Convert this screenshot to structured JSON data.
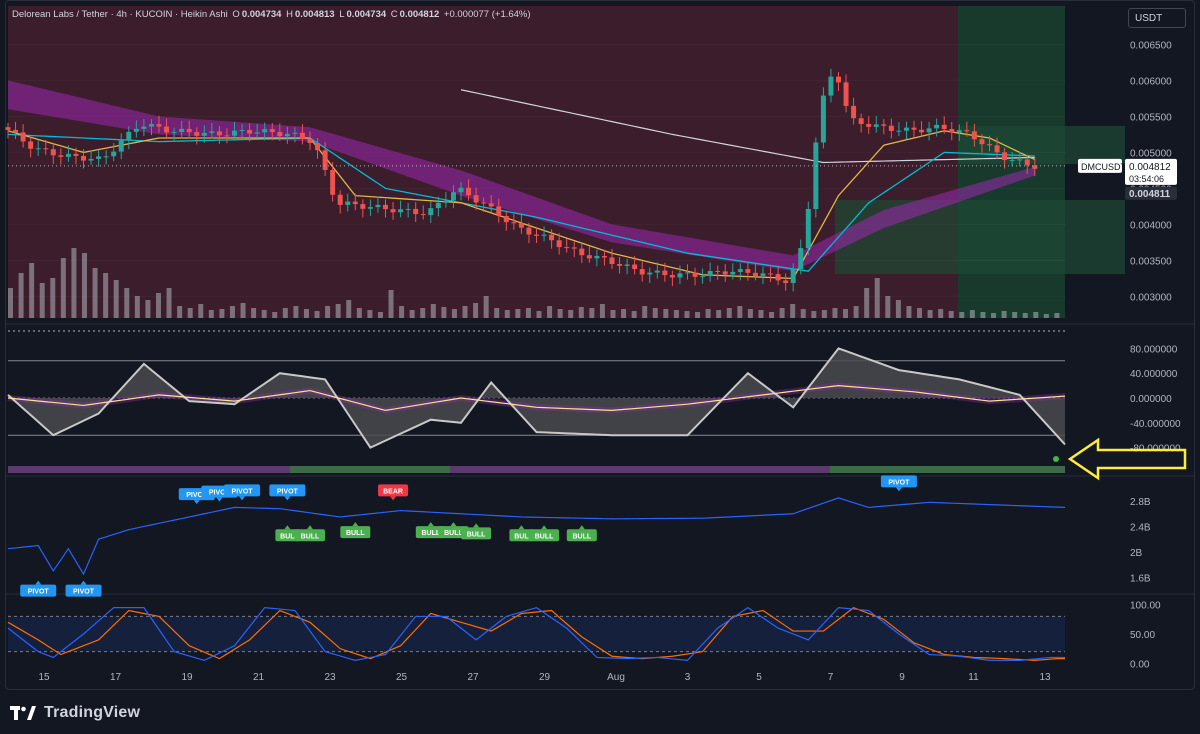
{
  "legend": {
    "title": "Delorean Labs / Tether · 4h · KUCOIN · Heikin Ashi",
    "open_label": "O",
    "open": "0.004734",
    "high_label": "H",
    "high": "0.004813",
    "low_label": "L",
    "low": "0.004734",
    "close_label": "C",
    "close": "0.004812",
    "change": "+0.000077 (+1.64%)"
  },
  "quote_currency": "USDT",
  "price_tags": {
    "symbol": "DMCUSDT",
    "last": "0.004812",
    "countdown": "03:54:06",
    "secondary": "0.004811"
  },
  "footer": {
    "brand": "TradingView"
  },
  "colors": {
    "background": "#131722",
    "bull": "#26a69a",
    "bear": "#ef5350",
    "ribbon": "#9c27b0",
    "pivot": "#2196f3",
    "bear_label": "#f23645",
    "bull_label": "#4caf50",
    "arrow": "#ffeb3b"
  },
  "chart_data": [
    {
      "type": "candlestick",
      "name": "main",
      "ylim": [
        0.0027,
        0.0067
      ],
      "y_ticks": [
        "0.006500",
        "0.006000",
        "0.005500",
        "0.005000",
        "0.004500",
        "0.004000",
        "0.003500",
        "0.003000"
      ],
      "x_ticks": [
        "15",
        "17",
        "19",
        "21",
        "23",
        "25",
        "27",
        "29",
        "Aug",
        "3",
        "5",
        "7",
        "9",
        "11",
        "13"
      ],
      "close_path": [
        [
          0,
          0.00535
        ],
        [
          4,
          0.00505
        ],
        [
          8,
          0.00495
        ],
        [
          13,
          0.0049
        ],
        [
          18,
          0.0054
        ],
        [
          22,
          0.0053
        ],
        [
          28,
          0.00525
        ],
        [
          33,
          0.0053
        ],
        [
          38,
          0.00525
        ],
        [
          41,
          0.00515
        ],
        [
          44,
          0.0043
        ],
        [
          48,
          0.00425
        ],
        [
          52,
          0.0042
        ],
        [
          56,
          0.00415
        ],
        [
          60,
          0.0045
        ],
        [
          64,
          0.00425
        ],
        [
          68,
          0.00395
        ],
        [
          72,
          0.0038
        ],
        [
          76,
          0.0036
        ],
        [
          80,
          0.0035
        ],
        [
          84,
          0.00335
        ],
        [
          88,
          0.0033
        ],
        [
          92,
          0.0033
        ],
        [
          96,
          0.00335
        ],
        [
          100,
          0.00332
        ],
        [
          104,
          0.0032
        ],
        [
          106,
          0.0038
        ],
        [
          108,
          0.0056
        ],
        [
          110,
          0.0062
        ],
        [
          112,
          0.00545
        ],
        [
          116,
          0.00535
        ],
        [
          120,
          0.0053
        ],
        [
          124,
          0.00535
        ],
        [
          128,
          0.00525
        ],
        [
          132,
          0.00495
        ],
        [
          136,
          0.00481
        ]
      ],
      "ma_long": [
        [
          60,
          0.00587
        ],
        [
          88,
          0.00525
        ],
        [
          108,
          0.00486
        ],
        [
          136,
          0.00493
        ]
      ],
      "ema_fast": [
        [
          0,
          0.0053
        ],
        [
          10,
          0.005
        ],
        [
          20,
          0.0052
        ],
        [
          40,
          0.0052
        ],
        [
          46,
          0.0044
        ],
        [
          60,
          0.0043
        ],
        [
          70,
          0.00395
        ],
        [
          80,
          0.0036
        ],
        [
          92,
          0.0033
        ],
        [
          104,
          0.00325
        ],
        [
          110,
          0.0044
        ],
        [
          116,
          0.0051
        ],
        [
          124,
          0.0053
        ],
        [
          130,
          0.0052
        ],
        [
          136,
          0.0049
        ]
      ],
      "ema_slow": [
        [
          0,
          0.00525
        ],
        [
          20,
          0.00515
        ],
        [
          40,
          0.0052
        ],
        [
          50,
          0.0045
        ],
        [
          70,
          0.0041
        ],
        [
          90,
          0.0036
        ],
        [
          106,
          0.00335
        ],
        [
          114,
          0.0043
        ],
        [
          124,
          0.005
        ],
        [
          136,
          0.00495
        ]
      ],
      "ribbon_top": [
        [
          0,
          0.006
        ],
        [
          20,
          0.0055
        ],
        [
          40,
          0.00535
        ],
        [
          60,
          0.00475
        ],
        [
          80,
          0.004
        ],
        [
          104,
          0.00357
        ],
        [
          116,
          0.0042
        ],
        [
          136,
          0.0048
        ]
      ],
      "ribbon_bottom": [
        [
          0,
          0.0056
        ],
        [
          20,
          0.00525
        ],
        [
          40,
          0.00515
        ],
        [
          60,
          0.0044
        ],
        [
          80,
          0.00375
        ],
        [
          104,
          0.00335
        ],
        [
          116,
          0.00395
        ],
        [
          136,
          0.00468
        ]
      ],
      "volume": [
        30,
        45,
        55,
        35,
        40,
        60,
        70,
        65,
        50,
        45,
        38,
        30,
        22,
        18,
        25,
        30,
        12,
        10,
        14,
        8,
        9,
        12,
        15,
        10,
        8,
        6,
        10,
        12,
        9,
        7,
        12,
        14,
        18,
        10,
        8,
        6,
        28,
        12,
        8,
        10,
        14,
        11,
        9,
        12,
        15,
        22,
        10,
        8,
        9,
        10,
        7,
        12,
        9,
        8,
        11,
        10,
        14,
        8,
        9,
        7,
        12,
        10,
        9,
        8,
        7,
        6,
        9,
        8,
        10,
        12,
        9,
        8,
        6,
        10,
        14,
        9,
        7,
        8,
        10,
        9,
        12,
        30,
        40,
        22,
        18,
        12,
        10,
        8,
        9,
        7,
        6,
        8,
        6,
        5,
        7,
        6,
        5,
        6,
        4,
        5
      ]
    },
    {
      "type": "line",
      "name": "oscillator",
      "ylim": [
        -100,
        100
      ],
      "y_ticks": [
        "80.000000",
        "40.000000",
        "0.000000",
        "-40.000000",
        "-80.000000"
      ],
      "levels": [
        60,
        -60
      ],
      "wave": [
        [
          0,
          5
        ],
        [
          6,
          -60
        ],
        [
          12,
          -25
        ],
        [
          18,
          55
        ],
        [
          24,
          -5
        ],
        [
          30,
          -10
        ],
        [
          36,
          40
        ],
        [
          42,
          30
        ],
        [
          48,
          -80
        ],
        [
          56,
          -35
        ],
        [
          60,
          -40
        ],
        [
          64,
          25
        ],
        [
          70,
          -55
        ],
        [
          80,
          -60
        ],
        [
          90,
          -60
        ],
        [
          98,
          40
        ],
        [
          104,
          -15
        ],
        [
          110,
          80
        ],
        [
          118,
          45
        ],
        [
          126,
          30
        ],
        [
          134,
          5
        ],
        [
          140,
          -75
        ]
      ],
      "signal": [
        [
          0,
          0
        ],
        [
          10,
          -12
        ],
        [
          20,
          5
        ],
        [
          30,
          -5
        ],
        [
          40,
          12
        ],
        [
          50,
          -20
        ],
        [
          60,
          0
        ],
        [
          70,
          -15
        ],
        [
          80,
          -20
        ],
        [
          90,
          -10
        ],
        [
          100,
          5
        ],
        [
          110,
          20
        ],
        [
          120,
          10
        ],
        [
          130,
          -5
        ],
        [
          140,
          3
        ]
      ]
    },
    {
      "type": "line",
      "name": "volume-trend",
      "ylim": [
        1.4,
        3.1
      ],
      "y_ticks": [
        "2.8B",
        "2.4B",
        "2B",
        "1.6B"
      ],
      "series": [
        [
          0,
          2.05
        ],
        [
          4,
          2.1
        ],
        [
          6,
          1.7
        ],
        [
          8,
          2.05
        ],
        [
          10,
          1.65
        ],
        [
          12,
          2.2
        ],
        [
          16,
          2.35
        ],
        [
          22,
          2.5
        ],
        [
          30,
          2.7
        ],
        [
          36,
          2.68
        ],
        [
          44,
          2.55
        ],
        [
          52,
          2.65
        ],
        [
          60,
          2.6
        ],
        [
          68,
          2.55
        ],
        [
          80,
          2.52
        ],
        [
          92,
          2.53
        ],
        [
          104,
          2.6
        ],
        [
          110,
          2.85
        ],
        [
          114,
          2.7
        ],
        [
          122,
          2.78
        ],
        [
          140,
          2.7
        ]
      ],
      "labels": [
        {
          "text": "PIVOT",
          "kind": "pivot-up",
          "x": 25,
          "y": 2.72
        },
        {
          "text": "PIVOT",
          "kind": "pivot-up",
          "x": 28,
          "y": 2.76
        },
        {
          "text": "PIVOT",
          "kind": "pivot-up",
          "x": 31,
          "y": 2.78
        },
        {
          "text": "PIVOT",
          "kind": "pivot-up",
          "x": 37,
          "y": 2.78
        },
        {
          "text": "BEAR",
          "kind": "bear",
          "x": 51,
          "y": 2.78
        },
        {
          "text": "PIVOT",
          "kind": "pivot-up",
          "x": 118,
          "y": 2.92
        },
        {
          "text": "PIVOT",
          "kind": "pivot-down",
          "x": 4,
          "y": 1.58
        },
        {
          "text": "PIVOT",
          "kind": "pivot-down",
          "x": 10,
          "y": 1.58
        },
        {
          "text": "BUL",
          "kind": "bull",
          "x": 37,
          "y": 2.45
        },
        {
          "text": "BULL",
          "kind": "bull",
          "x": 40,
          "y": 2.45
        },
        {
          "text": "BULL",
          "kind": "bull",
          "x": 46,
          "y": 2.5
        },
        {
          "text": "BULL",
          "kind": "bull",
          "x": 56,
          "y": 2.5
        },
        {
          "text": "BULL",
          "kind": "bull",
          "x": 59,
          "y": 2.5
        },
        {
          "text": "BULL",
          "kind": "bull",
          "x": 62,
          "y": 2.48
        },
        {
          "text": "BUL",
          "kind": "bull",
          "x": 68,
          "y": 2.45
        },
        {
          "text": "BULL",
          "kind": "bull",
          "x": 71,
          "y": 2.45
        },
        {
          "text": "BULL",
          "kind": "bull",
          "x": 76,
          "y": 2.45
        }
      ]
    },
    {
      "type": "line",
      "name": "stochastic",
      "ylim": [
        -8,
        108
      ],
      "y_ticks": [
        "100.00",
        "50.00",
        "0.00"
      ],
      "levels": [
        80,
        20
      ],
      "k": [
        [
          0,
          60
        ],
        [
          4,
          20
        ],
        [
          6,
          10
        ],
        [
          10,
          50
        ],
        [
          14,
          95
        ],
        [
          18,
          95
        ],
        [
          22,
          20
        ],
        [
          26,
          5
        ],
        [
          30,
          30
        ],
        [
          34,
          95
        ],
        [
          38,
          90
        ],
        [
          42,
          20
        ],
        [
          46,
          5
        ],
        [
          50,
          15
        ],
        [
          54,
          80
        ],
        [
          58,
          80
        ],
        [
          62,
          40
        ],
        [
          66,
          80
        ],
        [
          70,
          95
        ],
        [
          74,
          60
        ],
        [
          78,
          10
        ],
        [
          82,
          8
        ],
        [
          86,
          10
        ],
        [
          90,
          5
        ],
        [
          94,
          60
        ],
        [
          98,
          95
        ],
        [
          102,
          60
        ],
        [
          106,
          40
        ],
        [
          110,
          95
        ],
        [
          114,
          90
        ],
        [
          118,
          50
        ],
        [
          122,
          15
        ],
        [
          126,
          12
        ],
        [
          130,
          5
        ],
        [
          134,
          5
        ],
        [
          138,
          10
        ]
      ],
      "d": [
        [
          0,
          70
        ],
        [
          4,
          40
        ],
        [
          7,
          15
        ],
        [
          12,
          40
        ],
        [
          16,
          90
        ],
        [
          20,
          80
        ],
        [
          24,
          30
        ],
        [
          28,
          8
        ],
        [
          32,
          40
        ],
        [
          36,
          90
        ],
        [
          40,
          70
        ],
        [
          44,
          25
        ],
        [
          48,
          8
        ],
        [
          52,
          30
        ],
        [
          56,
          85
        ],
        [
          60,
          70
        ],
        [
          64,
          55
        ],
        [
          68,
          85
        ],
        [
          72,
          90
        ],
        [
          76,
          45
        ],
        [
          80,
          12
        ],
        [
          84,
          8
        ],
        [
          88,
          12
        ],
        [
          92,
          20
        ],
        [
          96,
          80
        ],
        [
          100,
          90
        ],
        [
          104,
          55
        ],
        [
          108,
          55
        ],
        [
          112,
          95
        ],
        [
          116,
          75
        ],
        [
          120,
          35
        ],
        [
          124,
          15
        ],
        [
          128,
          10
        ],
        [
          132,
          8
        ],
        [
          136,
          5
        ],
        [
          139,
          8
        ]
      ]
    }
  ]
}
